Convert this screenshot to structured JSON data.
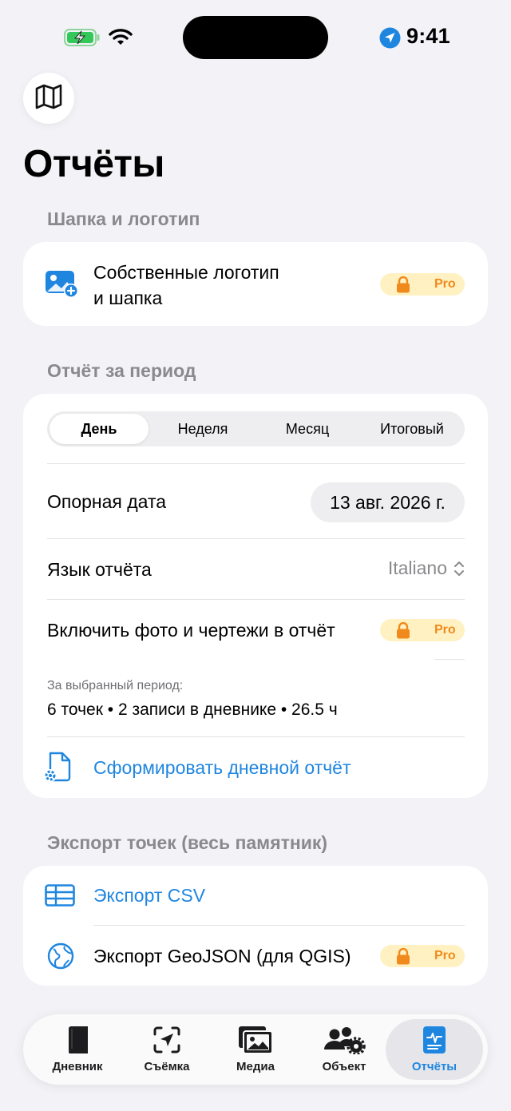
{
  "status_bar": {
    "time": "9:41"
  },
  "page": {
    "title": "Отчёты"
  },
  "header_section": {
    "title": "Шапка и логотип",
    "row_label_line1": "Собственные логотип",
    "row_label_line2": "и шапка",
    "badge": "Pro"
  },
  "period_section": {
    "title": "Отчёт за период",
    "segments": [
      "День",
      "Неделя",
      "Месяц",
      "Итоговый"
    ],
    "selected_segment": "День",
    "reference_date_label": "Опорная дата",
    "reference_date_value": "13 авг. 2026 г.",
    "language_label": "Язык отчёта",
    "language_value": "Italiano",
    "include_photos_label": "Включить фото и чертежи в отчёт",
    "include_photos_badge": "Pro",
    "summary_caption": "За выбранный период:",
    "summary_text": "6 точек • 2 записи в дневнике • 26.5 ч",
    "generate_button": "Сформировать дневной отчёт"
  },
  "export_section": {
    "title": "Экспорт точек (весь памятник)",
    "csv_label": "Экспорт CSV",
    "geojson_label": "Экспорт GeoJSON (для QGIS)",
    "geojson_badge": "Pro"
  },
  "tab_bar": {
    "tabs": [
      {
        "label": "Дневник",
        "icon": "book-icon"
      },
      {
        "label": "Съёмка",
        "icon": "survey-icon"
      },
      {
        "label": "Медиа",
        "icon": "photos-icon"
      },
      {
        "label": "Объект",
        "icon": "people-gear-icon"
      },
      {
        "label": "Отчёты",
        "icon": "report-icon"
      }
    ],
    "active": "Отчёты"
  },
  "colors": {
    "accent": "#1f86e0",
    "pro_badge_bg": "#fff1c2",
    "pro_badge_text": "#f08a1c",
    "background": "#f2f2f7"
  }
}
